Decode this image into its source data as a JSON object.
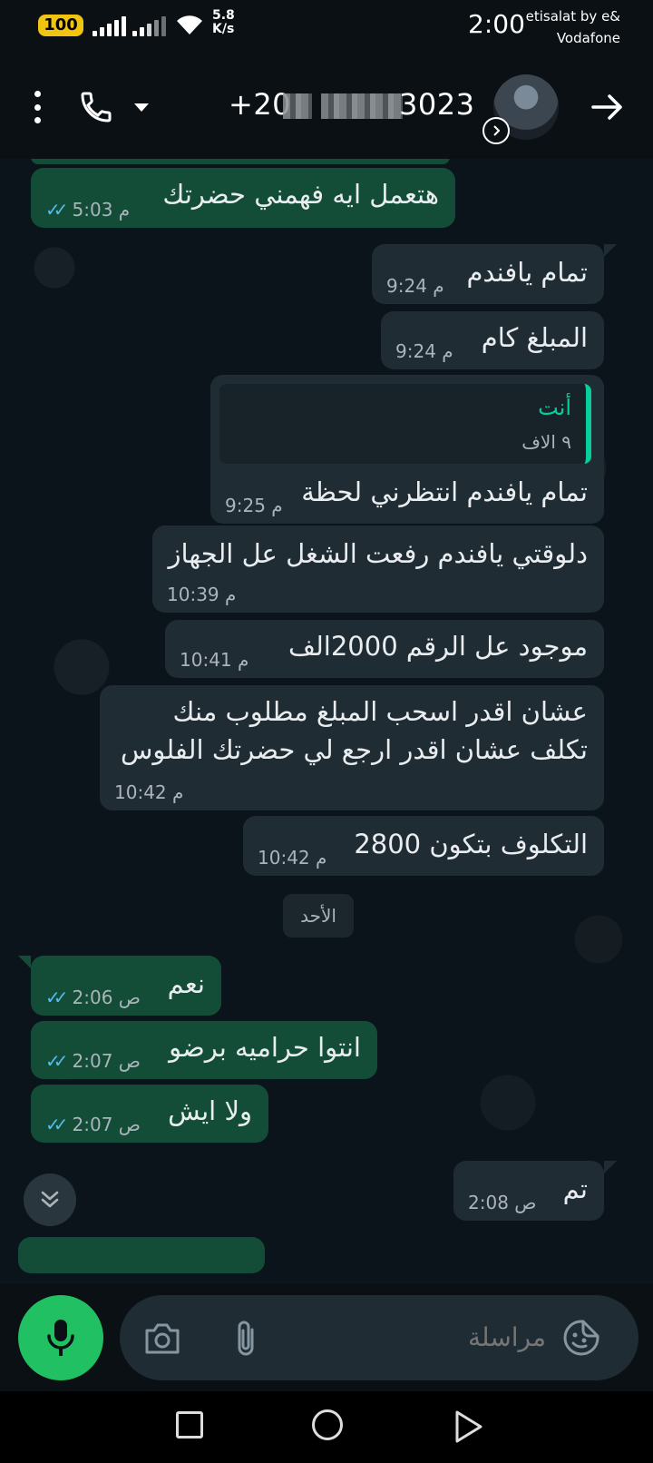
{
  "status_bar": {
    "battery": "100",
    "network_speed_value": "5.8",
    "network_speed_unit": "K/s",
    "time": "2:00",
    "carrier_line1": "etisalat by e&",
    "carrier_line2": "Vodafone"
  },
  "header": {
    "contact_prefix": "+20",
    "contact_suffix": "3023"
  },
  "messages": [
    {
      "direction": "out",
      "text": "هتعمل ايه فهمني حضرتك",
      "time": "5:03 م",
      "read": true
    },
    {
      "direction": "in",
      "text": "تمام يافندم",
      "time": "9:24 م"
    },
    {
      "direction": "in",
      "text": "المبلغ كام",
      "time": "9:24 م"
    },
    {
      "direction": "in",
      "quote_author": "أنت",
      "quote_text": "٩ الاف",
      "text": "تمام يافندم انتظرني لحظة",
      "time": "9:25 م"
    },
    {
      "direction": "in",
      "text": "دلوقتي يافندم رفعت الشغل عل الجهاز",
      "time": "10:39 م"
    },
    {
      "direction": "in",
      "text": "موجود عل الرقم 2000الف",
      "time": "10:41 م"
    },
    {
      "direction": "in",
      "text_line1": "عشان اقدر اسحب المبلغ مطلوب منك",
      "text_line2": "تكلف عشان اقدر ارجع لي حضرتك الفلوس",
      "time": "10:42 م"
    },
    {
      "direction": "in",
      "text": "التكلوف بتكون 2800",
      "time": "10:42 م"
    },
    {
      "direction": "out",
      "text": "نعم",
      "time": "2:06 ص",
      "read": true
    },
    {
      "direction": "out",
      "text": "انتوا حراميه برضو",
      "time": "2:07 ص",
      "read": true
    },
    {
      "direction": "out",
      "text": "ولا ايش",
      "time": "2:07 ص",
      "read": true
    },
    {
      "direction": "in",
      "text": "تم",
      "time": "2:08 ص"
    }
  ],
  "date_divider": "الأحد",
  "compose": {
    "placeholder": "مراسلة"
  },
  "icons": {
    "header": [
      "more-vert-icon",
      "phone-icon",
      "caret-down-icon",
      "avatar",
      "status-ring-icon",
      "arrow-right-icon"
    ],
    "input": [
      "mic-icon",
      "camera-icon",
      "paperclip-icon",
      "sticker-icon"
    ],
    "nav": [
      "recents-square-icon",
      "home-circle-icon",
      "back-triangle-icon"
    ],
    "scroll": "double-chevron-down-icon"
  },
  "colors": {
    "outgoing_bubble": "#144d37",
    "incoming_bubble": "#202c33",
    "accent_green": "#21c063",
    "read_ticks": "#53bdeb",
    "quote_accent": "#06cf9c"
  }
}
